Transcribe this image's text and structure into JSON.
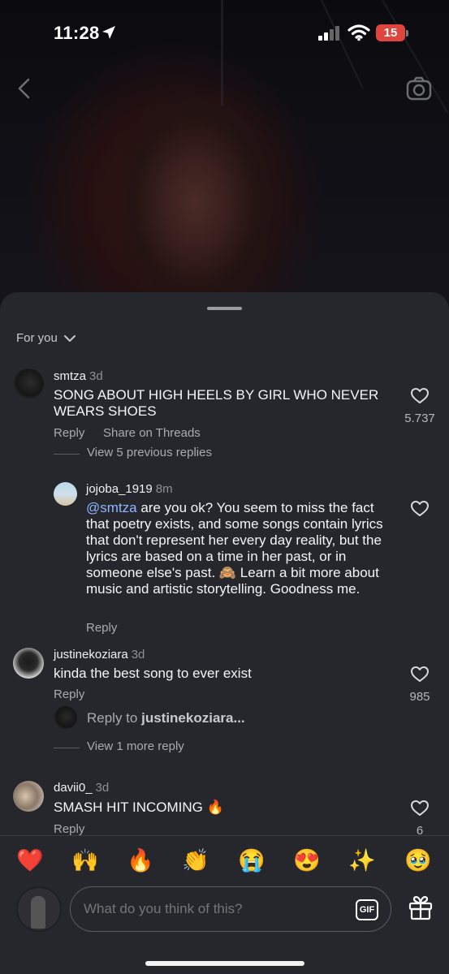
{
  "status": {
    "time": "11:28",
    "battery": "15"
  },
  "sheet": {
    "filter_label": "For you"
  },
  "comments": [
    {
      "user": "smtza",
      "time": "3d",
      "text": "SONG ABOUT HIGH HEELS BY GIRL WHO NEVER WEARS SHOES",
      "reply": "Reply",
      "share": "Share on Threads",
      "likes": "5.737",
      "view_replies": "View 5 previous replies"
    },
    {
      "user": "jojoba_1919",
      "time": "8m",
      "mention": "@smtza",
      "text": " are you ok? You seem to miss the fact that poetry exists, and some songs contain lyrics that don't represent her every day reality, but the lyrics are based on a time in her  past, or in someone else's past. 🙈 Learn a bit more about music and artistic storytelling. Goodness me.",
      "reply": "Reply"
    },
    {
      "user": "justinekoziara",
      "time": "3d",
      "text": "kinda the best song to ever exist",
      "reply": "Reply",
      "likes": "985",
      "reply_to_prefix": "Reply to ",
      "reply_to_user": "justinekoziara...",
      "view_more": "View 1 more reply"
    },
    {
      "user": "davii0_",
      "time": "3d",
      "text": "SMASH HIT INCOMING 🔥",
      "reply": "Reply",
      "likes": "6"
    }
  ],
  "reactions": [
    "❤️",
    "🙌",
    "🔥",
    "👏",
    "😭",
    "😍",
    "✨",
    "🥹"
  ],
  "composer": {
    "placeholder": "What do you think of this?",
    "gif_label": "GIF"
  },
  "icons": [
    "location-arrow-icon",
    "signal-icon",
    "wifi-icon",
    "back-icon",
    "camera-icon",
    "chevron-down-icon",
    "heart-icon",
    "gift-icon"
  ],
  "colors": {
    "sheet_bg": "#25272d",
    "mention": "#8fb6ff",
    "battery_low": "#e0443e"
  }
}
